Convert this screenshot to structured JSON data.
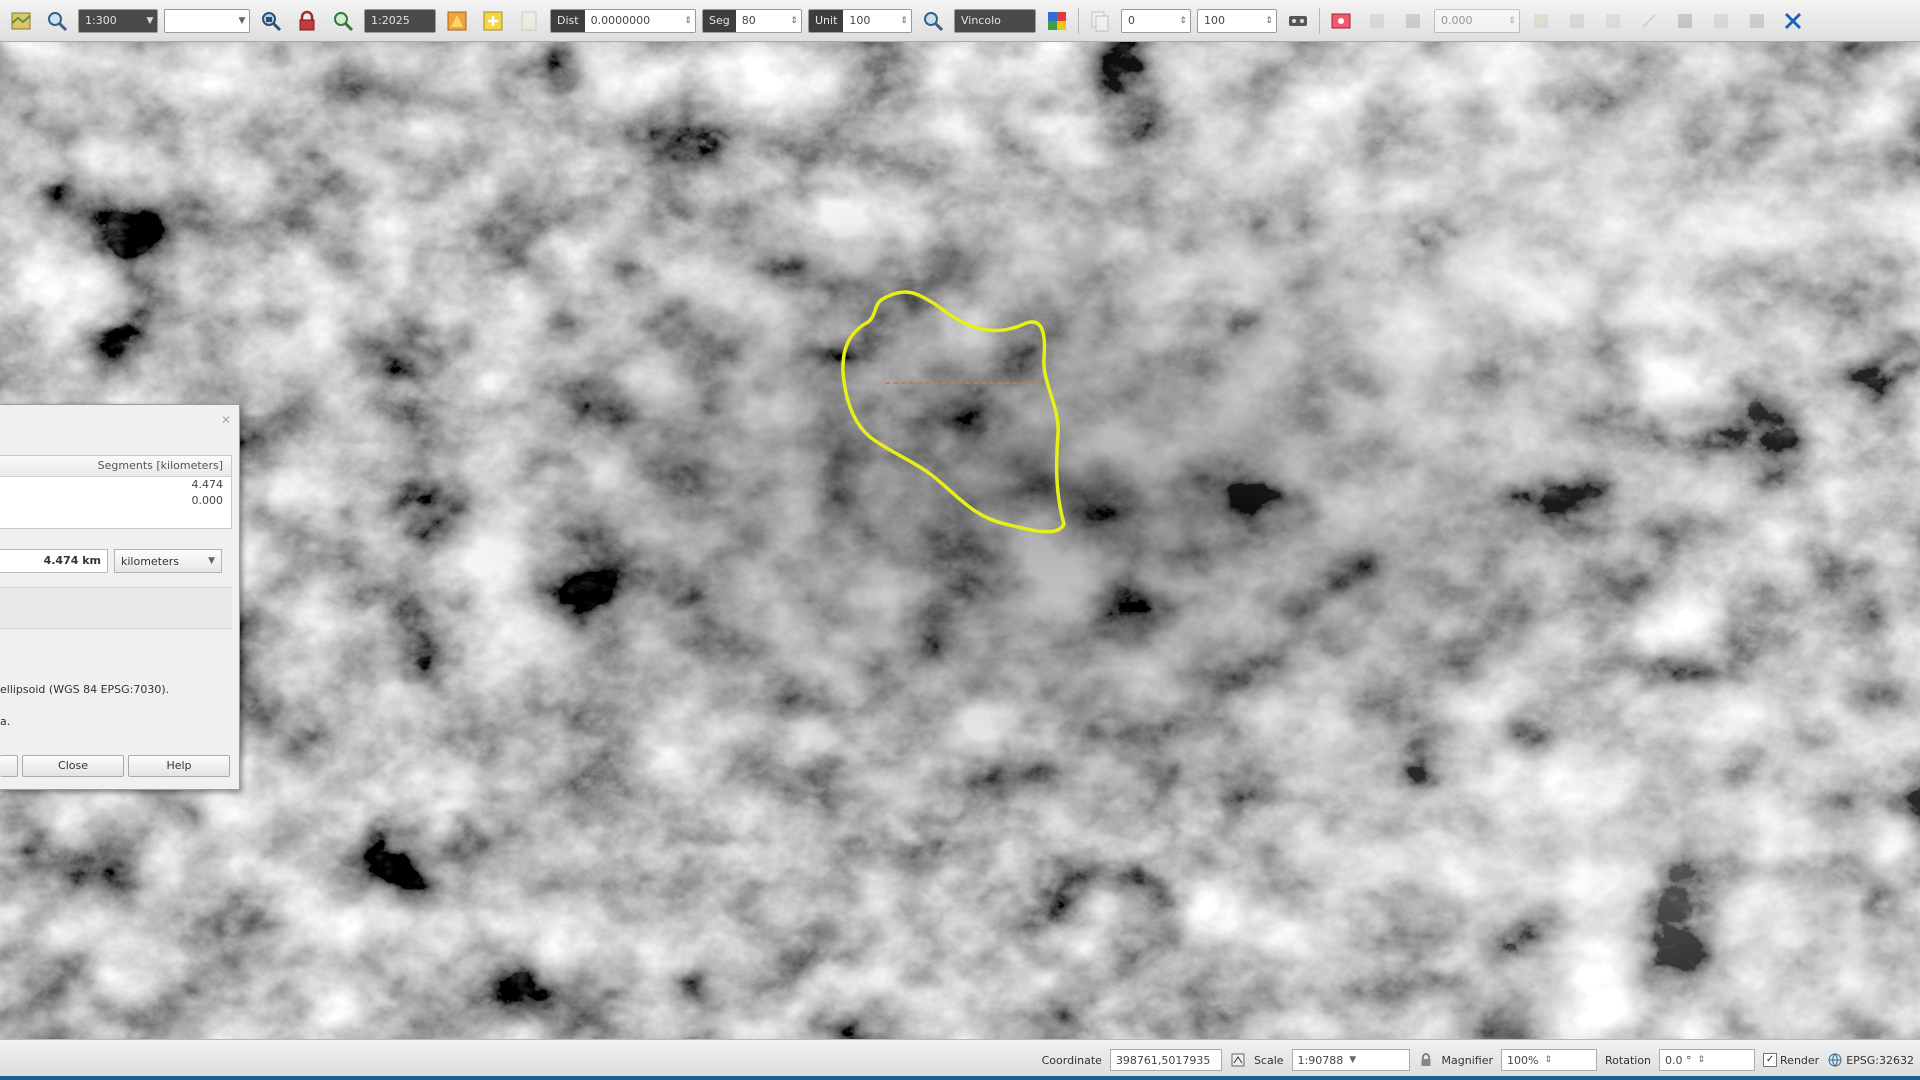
{
  "toolbar": {
    "combo_zoom": {
      "value": "1:300",
      "dark": true
    },
    "combo_blank": {
      "value": ""
    },
    "combo_vertex": {
      "value": "1:2025"
    },
    "tolerance": {
      "label": "Dist",
      "value": "0.0000000"
    },
    "segments": {
      "label": "Seg",
      "value": "80"
    },
    "units": {
      "label": "Unit",
      "value": "100"
    },
    "search": {
      "value": "Vincolo"
    },
    "offset_x": {
      "value": "0"
    },
    "offset_y": {
      "value": "100"
    },
    "angle": {
      "value": "0.000"
    }
  },
  "measure_dialog": {
    "column_header": "Segments [kilometers]",
    "segments": [
      "4.474",
      "0.000"
    ],
    "total_value": "4.474 km",
    "unit_selected": "kilometers",
    "info_text_line1": "ellipsoid (WGS 84 EPSG:7030).",
    "info_text_line2": "a.",
    "close_button": "Close",
    "help_button": "Help"
  },
  "statusbar": {
    "coordinate_label": "Coordinate",
    "coordinate_value": "398761,5017935",
    "scale_label": "Scale",
    "scale_value": "1:90788",
    "magnifier_label": "Magnifier",
    "magnifier_value": "100%",
    "rotation_label": "Rotation",
    "rotation_value": "0.0 °",
    "render_label": "Render",
    "crs_label": "EPSG:32632"
  },
  "colors": {
    "boundary": "#e6ef18",
    "measure_line": "#c8785a"
  }
}
